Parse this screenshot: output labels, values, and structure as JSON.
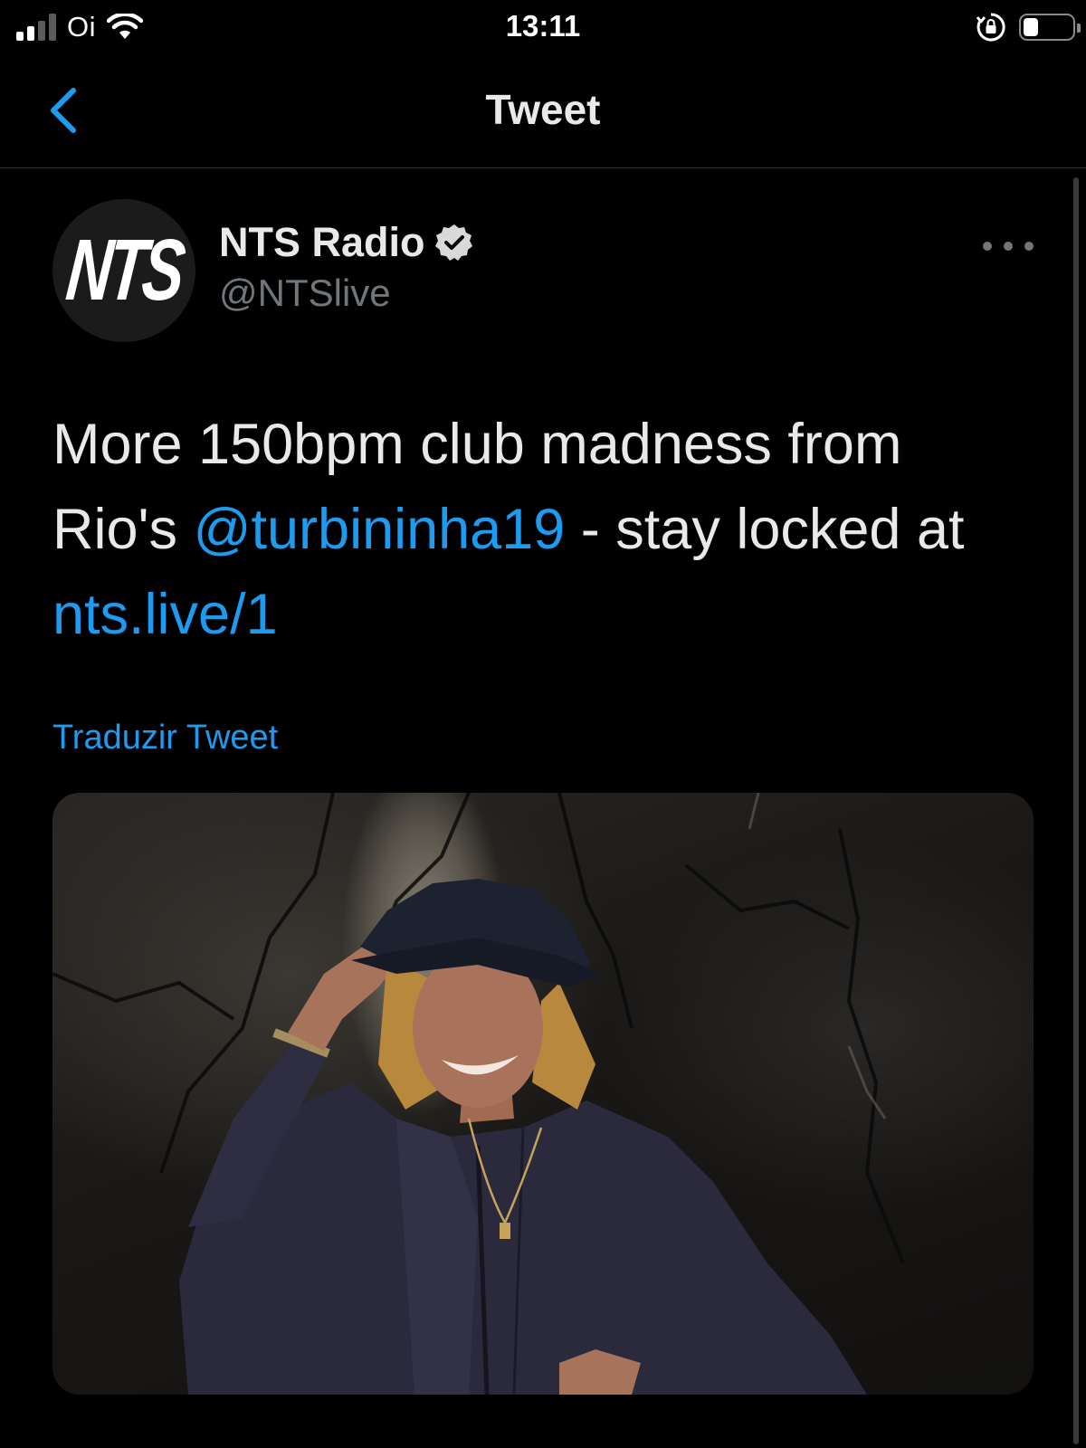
{
  "status_bar": {
    "carrier": "Oi",
    "time": "13:11",
    "battery_level": 0.28,
    "signal_bars": 2
  },
  "nav": {
    "title": "Tweet",
    "back_icon": "chevron-left-icon"
  },
  "tweet": {
    "avatar_text": "NTS",
    "display_name": "NTS Radio",
    "handle": "@NTSlive",
    "verified": true,
    "text_before_mention": "More 150bpm club madness from Rio's ",
    "mention": "@turbininha19",
    "text_after_mention": " - stay locked at ",
    "link": "nts.live/1",
    "translate_label": "Traduzir Tweet"
  },
  "colors": {
    "background": "#000000",
    "accent": "#1d9bf0",
    "primary_text": "#e7e9ea",
    "secondary_text": "#71767b"
  }
}
